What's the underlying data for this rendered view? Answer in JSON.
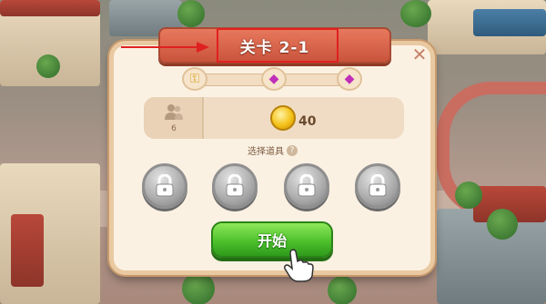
{
  "level": {
    "title": "关卡 2-1"
  },
  "progress_rewards": [
    {
      "icon": "key-icon",
      "glyph": "⚿"
    },
    {
      "icon": "gem-icon",
      "glyph": "◆"
    },
    {
      "icon": "gem-icon",
      "glyph": "◆"
    }
  ],
  "info": {
    "players": "6",
    "coins": "40"
  },
  "props": {
    "label": "选择道具",
    "help": "?",
    "slots": [
      {
        "state": "locked"
      },
      {
        "state": "locked"
      },
      {
        "state": "locked"
      },
      {
        "state": "locked"
      }
    ]
  },
  "buttons": {
    "start_label": "开始",
    "close_glyph": "✕"
  },
  "colors": {
    "annotation": "#e02020",
    "title_banner": "#d35f44",
    "start_button": "#4dc12c",
    "panel": "#fbf1e3"
  }
}
